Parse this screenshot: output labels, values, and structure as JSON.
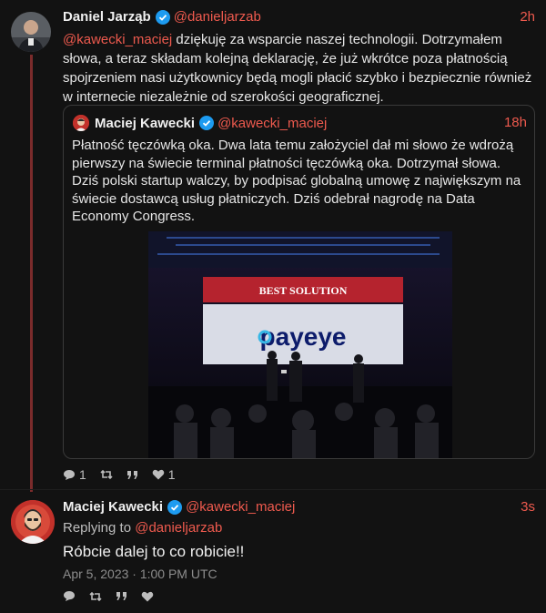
{
  "colors": {
    "accent": "#ee5a4e",
    "verified": "#1d9bf0",
    "background": "#121212"
  },
  "tweet": {
    "author": "Daniel Jarząb",
    "handle": "@danieljarzab",
    "time": "2h",
    "mention": "@kawecki_maciej",
    "text": " dziękuję za wsparcie naszej technologii. Dotrzymałem słowa, a teraz składam kolejną deklarację, że już wkrótce poza płatnością spojrzeniem nasi użytkownicy będą mogli płacić szybko i bezpiecznie również w internecie niezależnie od szerokości geograficznej.",
    "stats": {
      "replies": "1",
      "likes": "1"
    }
  },
  "quoted": {
    "author": "Maciej Kawecki",
    "handle": "@kawecki_maciej",
    "time": "18h",
    "text": "Płatność tęczówką oka. Dwa lata temu założyciel dał mi słowo że wdrożą pierwszy na świecie terminal płatności tęczówką oka. Dotrzymał słowa. Dziś polski startup walczy, by podpisać globalną umowę z największym na świecie dostawcą usług płatniczych. Dziś odebrał nagrodę na Data Economy Congress.",
    "image": {
      "banner": "BEST SOLUTION",
      "logo": "payeye"
    }
  },
  "reply": {
    "author": "Maciej Kawecki",
    "handle": "@kawecki_maciej",
    "time": "3s",
    "replying_label": "Replying to ",
    "replying_handle": "@danieljarzab",
    "text": "Róbcie dalej to co robicie!!",
    "date": "Apr 5, 2023 · 1:00 PM UTC"
  }
}
